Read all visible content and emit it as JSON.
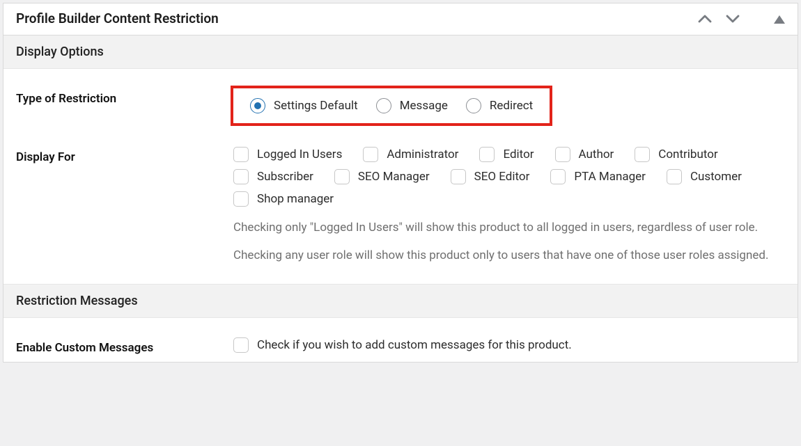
{
  "panel": {
    "title": "Profile Builder Content Restriction"
  },
  "sections": {
    "display_options_title": "Display Options",
    "restriction_messages_title": "Restriction Messages"
  },
  "restriction_type": {
    "label": "Type of Restriction",
    "options": [
      {
        "label": "Settings Default",
        "checked": true
      },
      {
        "label": "Message",
        "checked": false
      },
      {
        "label": "Redirect",
        "checked": false
      }
    ]
  },
  "display_for": {
    "label": "Display For",
    "roles": [
      "Logged In Users",
      "Administrator",
      "Editor",
      "Author",
      "Contributor",
      "Subscriber",
      "SEO Manager",
      "SEO Editor",
      "PTA Manager",
      "Customer",
      "Shop manager"
    ],
    "desc1": "Checking only \"Logged In Users\" will show this product to all logged in users, regardless of user role.",
    "desc2": "Checking any user role will show this product only to users that have one of those user roles assigned."
  },
  "custom_messages": {
    "label": "Enable Custom Messages",
    "checkbox_text": "Check if you wish to add custom messages for this product."
  }
}
